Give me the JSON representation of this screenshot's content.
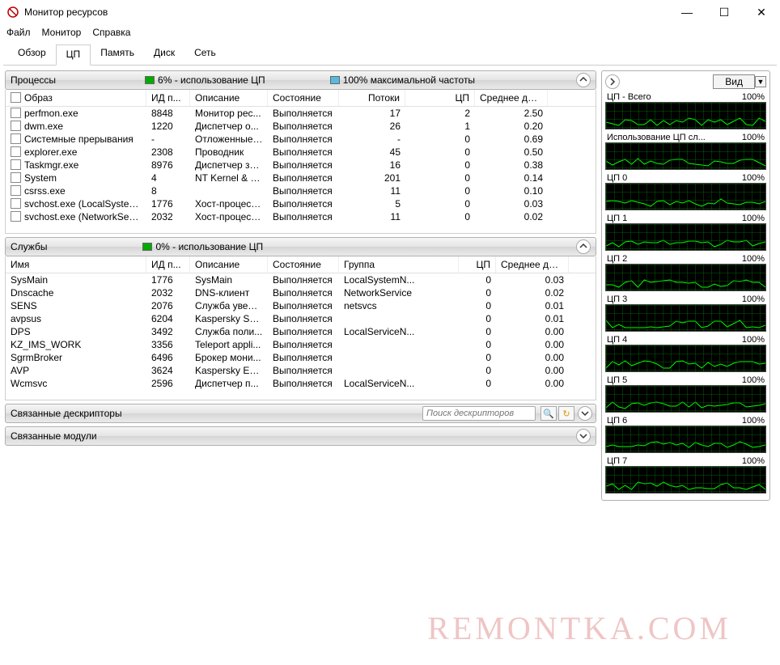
{
  "window": {
    "title": "Монитор ресурсов",
    "menu": [
      "Файл",
      "Монитор",
      "Справка"
    ],
    "tabs": [
      "Обзор",
      "ЦП",
      "Память",
      "Диск",
      "Сеть"
    ],
    "active_tab": 1
  },
  "processes": {
    "title": "Процессы",
    "metric1": "6% - использование ЦП",
    "metric2": "100% максимальной частоты",
    "columns": [
      "Образ",
      "ИД п...",
      "Описание",
      "Состояние",
      "Потоки",
      "ЦП",
      "Среднее для ..."
    ],
    "rows": [
      {
        "img": "perfmon.exe",
        "pid": "8848",
        "desc": "Монитор рес...",
        "state": "Выполняется",
        "threads": "17",
        "cpu": "2",
        "avg": "2.50"
      },
      {
        "img": "dwm.exe",
        "pid": "1220",
        "desc": "Диспетчер о...",
        "state": "Выполняется",
        "threads": "26",
        "cpu": "1",
        "avg": "0.20"
      },
      {
        "img": "Системные прерывания",
        "pid": "-",
        "desc": "Отложенные ...",
        "state": "Выполняется",
        "threads": "-",
        "cpu": "0",
        "avg": "0.69"
      },
      {
        "img": "explorer.exe",
        "pid": "2308",
        "desc": "Проводник",
        "state": "Выполняется",
        "threads": "45",
        "cpu": "0",
        "avg": "0.50"
      },
      {
        "img": "Taskmgr.exe",
        "pid": "8976",
        "desc": "Диспетчер за...",
        "state": "Выполняется",
        "threads": "16",
        "cpu": "0",
        "avg": "0.38"
      },
      {
        "img": "System",
        "pid": "4",
        "desc": "NT Kernel & S...",
        "state": "Выполняется",
        "threads": "201",
        "cpu": "0",
        "avg": "0.14"
      },
      {
        "img": "csrss.exe",
        "pid": "8",
        "desc": "",
        "state": "Выполняется",
        "threads": "11",
        "cpu": "0",
        "avg": "0.10"
      },
      {
        "img": "svchost.exe (LocalSystemNet...",
        "pid": "1776",
        "desc": "Хост-процесс...",
        "state": "Выполняется",
        "threads": "5",
        "cpu": "0",
        "avg": "0.03"
      },
      {
        "img": "svchost.exe (NetworkService...",
        "pid": "2032",
        "desc": "Хост-процесс...",
        "state": "Выполняется",
        "threads": "11",
        "cpu": "0",
        "avg": "0.02"
      }
    ]
  },
  "services": {
    "title": "Службы",
    "metric1": "0% - использование ЦП",
    "columns": [
      "Имя",
      "ИД п...",
      "Описание",
      "Состояние",
      "Группа",
      "ЦП",
      "Среднее для ..."
    ],
    "rows": [
      {
        "name": "SysMain",
        "pid": "1776",
        "desc": "SysMain",
        "state": "Выполняется",
        "group": "LocalSystemN...",
        "cpu": "0",
        "avg": "0.03"
      },
      {
        "name": "Dnscache",
        "pid": "2032",
        "desc": "DNS-клиент",
        "state": "Выполняется",
        "group": "NetworkService",
        "cpu": "0",
        "avg": "0.02"
      },
      {
        "name": "SENS",
        "pid": "2076",
        "desc": "Служба уведо...",
        "state": "Выполняется",
        "group": "netsvcs",
        "cpu": "0",
        "avg": "0.01"
      },
      {
        "name": "avpsus",
        "pid": "6204",
        "desc": "Kaspersky Sea...",
        "state": "Выполняется",
        "group": "",
        "cpu": "0",
        "avg": "0.01"
      },
      {
        "name": "DPS",
        "pid": "3492",
        "desc": "Служба поли...",
        "state": "Выполняется",
        "group": "LocalServiceN...",
        "cpu": "0",
        "avg": "0.00"
      },
      {
        "name": "KZ_IMS_WORK",
        "pid": "3356",
        "desc": "Teleport appli...",
        "state": "Выполняется",
        "group": "",
        "cpu": "0",
        "avg": "0.00"
      },
      {
        "name": "SgrmBroker",
        "pid": "6496",
        "desc": "Брокер мони...",
        "state": "Выполняется",
        "group": "",
        "cpu": "0",
        "avg": "0.00"
      },
      {
        "name": "AVP",
        "pid": "3624",
        "desc": "Kaspersky End...",
        "state": "Выполняется",
        "group": "",
        "cpu": "0",
        "avg": "0.00"
      },
      {
        "name": "Wcmsvc",
        "pid": "2596",
        "desc": "Диспетчер п...",
        "state": "Выполняется",
        "group": "LocalServiceN...",
        "cpu": "0",
        "avg": "0.00"
      }
    ]
  },
  "handles": {
    "title": "Связанные дескрипторы",
    "search_placeholder": "Поиск дескрипторов"
  },
  "modules": {
    "title": "Связанные модули"
  },
  "graphs": {
    "view_button": "Вид",
    "items": [
      {
        "label": "ЦП - Всего",
        "pct": "100%"
      },
      {
        "label": "Использование ЦП сл...",
        "pct": "100%"
      },
      {
        "label": "ЦП 0",
        "pct": "100%"
      },
      {
        "label": "ЦП 1",
        "pct": "100%"
      },
      {
        "label": "ЦП 2",
        "pct": "100%"
      },
      {
        "label": "ЦП 3",
        "pct": "100%"
      },
      {
        "label": "ЦП 4",
        "pct": "100%"
      },
      {
        "label": "ЦП 5",
        "pct": "100%"
      },
      {
        "label": "ЦП 6",
        "pct": "100%"
      },
      {
        "label": "ЦП 7",
        "pct": "100%"
      }
    ]
  },
  "watermark": "REMONTKA.COM"
}
